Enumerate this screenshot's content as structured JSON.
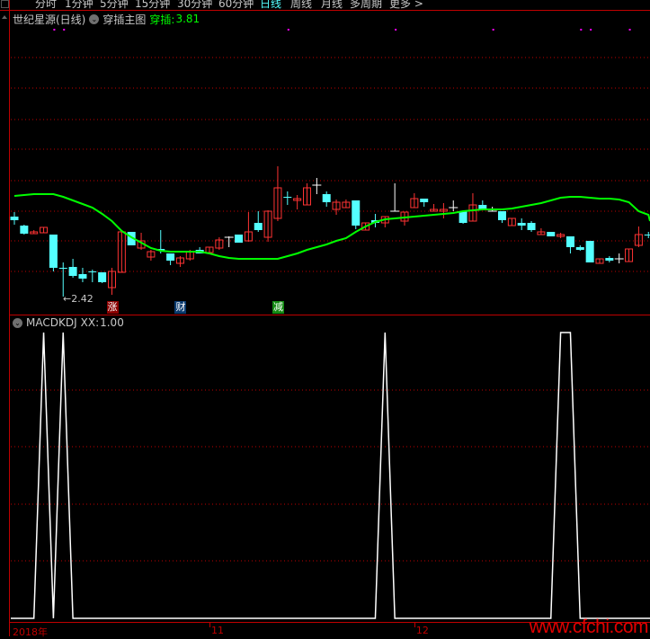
{
  "toolbar": {
    "items": [
      {
        "label": "分时",
        "active": false
      },
      {
        "label": "1分钟",
        "active": false
      },
      {
        "label": "5分钟",
        "active": false
      },
      {
        "label": "15分钟",
        "active": false
      },
      {
        "label": "30分钟",
        "active": false
      },
      {
        "label": "60分钟",
        "active": false
      },
      {
        "label": "日线",
        "active": true
      },
      {
        "label": "周线",
        "active": false
      },
      {
        "label": "月线",
        "active": false
      },
      {
        "label": "多周期",
        "active": false
      },
      {
        "label": "更多 >",
        "active": false
      }
    ]
  },
  "main_chart": {
    "stock_title": "世纪星源(日线)",
    "indicator_name": "穿插主图",
    "indicator_value_label": "穿插:",
    "indicator_value": "3.81",
    "low_marker": "←2.42",
    "tags": [
      {
        "text": "涨",
        "color": "#8b0000",
        "candle": 11
      },
      {
        "text": "财",
        "color": "#0a3a6e",
        "candle": 18
      },
      {
        "text": "减",
        "color": "#138a13",
        "candle": 28
      }
    ]
  },
  "sub_chart": {
    "indicator_name": "MACDKDJ",
    "value_label": "XX:",
    "value": "1.00"
  },
  "x_axis": {
    "labels": [
      {
        "text": "2018年",
        "candle": 0
      },
      {
        "text": "11",
        "candle": 20
      },
      {
        "text": "12",
        "candle": 41
      }
    ]
  },
  "watermark": "www.cfchi.com",
  "colors": {
    "up": "#ff3333",
    "down": "#54ffff",
    "doji": "#ffffff",
    "ma": "#00ff00",
    "grid": "#c00000",
    "frame": "#c00000",
    "signal_dot": "#ff00ff",
    "xx_line": "#ffffff"
  },
  "chart_data": {
    "type": "candlestick",
    "candles": [
      [
        3.31,
        3.36,
        3.22,
        3.27
      ],
      [
        3.21,
        3.22,
        3.11,
        3.12
      ],
      [
        3.12,
        3.16,
        3.12,
        3.14
      ],
      [
        3.13,
        3.19,
        3.13,
        3.19
      ],
      [
        3.11,
        3.11,
        2.7,
        2.74
      ],
      [
        2.74,
        2.8,
        2.42,
        2.73
      ],
      [
        2.75,
        2.84,
        2.63,
        2.65
      ],
      [
        2.67,
        2.74,
        2.58,
        2.62
      ],
      [
        2.7,
        2.72,
        2.58,
        2.69
      ],
      [
        2.69,
        2.69,
        2.57,
        2.58
      ],
      [
        2.52,
        2.74,
        2.44,
        2.7
      ],
      [
        2.69,
        3.14,
        2.69,
        3.14
      ],
      [
        3.14,
        3.14,
        2.99,
        2.99
      ],
      [
        2.96,
        3.13,
        2.94,
        3.04
      ],
      [
        2.86,
        2.94,
        2.82,
        2.92
      ],
      [
        2.95,
        3.16,
        2.9,
        2.93
      ],
      [
        2.9,
        2.9,
        2.77,
        2.82
      ],
      [
        2.79,
        2.87,
        2.75,
        2.85
      ],
      [
        2.84,
        2.94,
        2.82,
        2.92
      ],
      [
        2.94,
        2.97,
        2.9,
        2.9
      ],
      [
        2.91,
        2.97,
        2.91,
        2.97
      ],
      [
        2.96,
        3.08,
        2.94,
        3.05
      ],
      [
        3.08,
        3.09,
        2.97,
        3.08
      ],
      [
        3.11,
        3.11,
        3.02,
        3.02
      ],
      [
        3.04,
        3.36,
        3.03,
        3.14
      ],
      [
        3.24,
        3.37,
        3.14,
        3.16
      ],
      [
        3.08,
        3.38,
        3.03,
        3.37
      ],
      [
        3.29,
        3.87,
        3.26,
        3.63
      ],
      [
        3.53,
        3.59,
        3.44,
        3.52
      ],
      [
        3.49,
        3.55,
        3.39,
        3.51
      ],
      [
        3.44,
        3.68,
        3.44,
        3.63
      ],
      [
        3.66,
        3.74,
        3.56,
        3.66
      ],
      [
        3.56,
        3.59,
        3.42,
        3.47
      ],
      [
        3.39,
        3.5,
        3.33,
        3.47
      ],
      [
        3.41,
        3.5,
        3.41,
        3.47
      ],
      [
        3.49,
        3.49,
        3.17,
        3.21
      ],
      [
        3.16,
        3.24,
        3.16,
        3.24
      ],
      [
        3.27,
        3.34,
        3.19,
        3.24
      ],
      [
        3.24,
        3.31,
        3.19,
        3.31
      ],
      [
        3.37,
        3.68,
        3.37,
        3.37
      ],
      [
        3.26,
        3.36,
        3.21,
        3.36
      ],
      [
        3.41,
        3.57,
        3.41,
        3.51
      ],
      [
        3.51,
        3.51,
        3.42,
        3.47
      ],
      [
        3.37,
        3.45,
        3.37,
        3.39
      ],
      [
        3.37,
        3.46,
        3.29,
        3.39
      ],
      [
        3.41,
        3.49,
        3.37,
        3.41
      ],
      [
        3.37,
        3.37,
        3.23,
        3.24
      ],
      [
        3.26,
        3.57,
        3.26,
        3.44
      ],
      [
        3.44,
        3.49,
        3.39,
        3.39
      ],
      [
        3.37,
        3.42,
        3.37,
        3.37
      ],
      [
        3.37,
        3.37,
        3.24,
        3.27
      ],
      [
        3.21,
        3.29,
        3.21,
        3.29
      ],
      [
        3.24,
        3.29,
        3.16,
        3.21
      ],
      [
        3.24,
        3.26,
        3.14,
        3.16
      ],
      [
        3.11,
        3.18,
        3.11,
        3.14
      ],
      [
        3.14,
        3.14,
        3.09,
        3.09
      ],
      [
        3.09,
        3.13,
        3.07,
        3.11
      ],
      [
        3.09,
        3.09,
        2.9,
        2.97
      ],
      [
        2.97,
        2.99,
        2.93,
        2.94
      ],
      [
        3.04,
        3.04,
        2.8,
        2.8
      ],
      [
        2.79,
        2.84,
        2.79,
        2.84
      ],
      [
        2.85,
        2.87,
        2.8,
        2.82
      ],
      [
        2.84,
        2.9,
        2.79,
        2.84
      ],
      [
        2.81,
        2.95,
        2.81,
        2.95
      ],
      [
        2.99,
        3.2,
        2.97,
        3.11
      ],
      [
        3.11,
        3.14,
        3.07,
        3.1
      ]
    ],
    "ma": [
      3.54,
      3.55,
      3.56,
      3.56,
      3.56,
      3.53,
      3.49,
      3.45,
      3.41,
      3.34,
      3.26,
      3.15,
      3.08,
      3.02,
      2.96,
      2.93,
      2.92,
      2.92,
      2.92,
      2.92,
      2.9,
      2.87,
      2.85,
      2.84,
      2.84,
      2.84,
      2.84,
      2.84,
      2.87,
      2.9,
      2.94,
      2.97,
      3.0,
      3.04,
      3.07,
      3.14,
      3.2,
      3.25,
      3.28,
      3.29,
      3.3,
      3.31,
      3.32,
      3.33,
      3.34,
      3.35,
      3.37,
      3.38,
      3.39,
      3.39,
      3.39,
      3.4,
      3.42,
      3.44,
      3.46,
      3.49,
      3.52,
      3.53,
      3.53,
      3.52,
      3.51,
      3.51,
      3.5,
      3.47,
      3.37,
      3.33
    ],
    "signal_dots": [
      4,
      5,
      28,
      39,
      49,
      58,
      59,
      63
    ],
    "xx": [
      0,
      0,
      0,
      1,
      0,
      1,
      0,
      0,
      0,
      0,
      0,
      0,
      0,
      0,
      0,
      0,
      0,
      0,
      0,
      0,
      0,
      0,
      0,
      0,
      0,
      0,
      0,
      0,
      0,
      0,
      0,
      0,
      0,
      0,
      0,
      0,
      0,
      0,
      1,
      0,
      0,
      0,
      0,
      0,
      0,
      0,
      0,
      0,
      0,
      0,
      0,
      0,
      0,
      0,
      0,
      0,
      1,
      1,
      0,
      0,
      0,
      0,
      0,
      0,
      0,
      0
    ],
    "xx_range": [
      0,
      1
    ],
    "grid": true
  }
}
